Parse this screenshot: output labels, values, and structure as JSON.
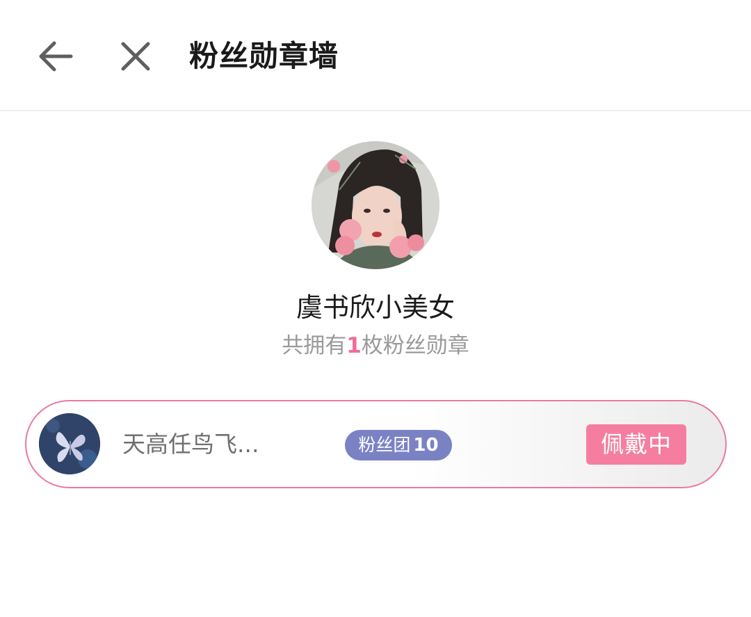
{
  "header": {
    "title": "粉丝勋章墙",
    "back_icon": "arrow-left-icon",
    "close_icon": "close-icon"
  },
  "profile": {
    "username": "虞书欣小美女",
    "badge_count_prefix": "共拥有",
    "badge_count": "1",
    "badge_count_suffix": "枚粉丝勋章"
  },
  "badges": [
    {
      "name": "天高任鸟飞...",
      "pill_label": "粉丝团",
      "level": "10",
      "status": "佩戴中"
    }
  ],
  "colors": {
    "accent_pink": "#ec6f98",
    "card_border": "#ea79a1",
    "pill_bg": "#7b82c4",
    "wear_tag_bg": "#f57ea0"
  }
}
